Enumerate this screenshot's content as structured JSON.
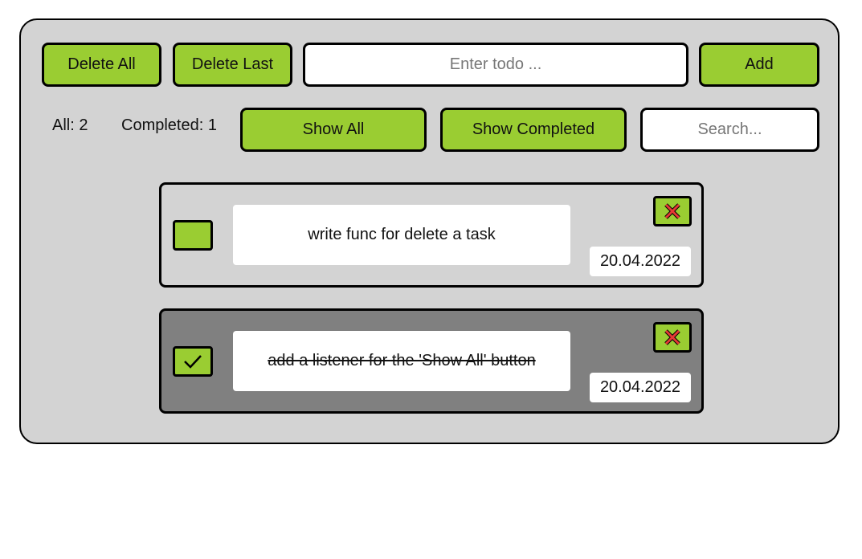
{
  "toolbar": {
    "delete_all_label": "Delete All",
    "delete_last_label": "Delete Last",
    "todo_input_placeholder": "Enter todo ...",
    "todo_input_value": "",
    "add_label": "Add"
  },
  "stats": {
    "all": "All: 2",
    "completed": "Completed: 1"
  },
  "filters": {
    "show_all_label": "Show All",
    "show_completed_label": "Show Completed",
    "search_placeholder": "Search...",
    "search_value": ""
  },
  "tasks": [
    {
      "text": "write func for delete a task",
      "date": "20.04.2022",
      "completed": false
    },
    {
      "text": "add a listener for the 'Show All' button",
      "date": "20.04.2022",
      "completed": true
    }
  ],
  "icons": {
    "delete": "close-x-icon",
    "check": "checkmark-icon"
  },
  "colors": {
    "accent": "#9acd32",
    "panel": "#d3d3d3",
    "completed_task": "#808080",
    "delete_x": "#e53935"
  }
}
